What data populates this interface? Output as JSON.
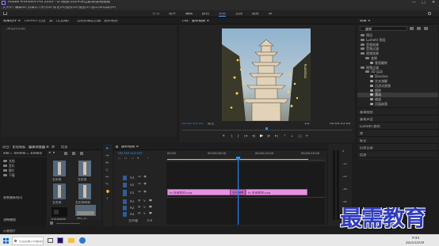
{
  "window": {
    "title": "Adobe Premiere Pro 2020 - D:\\视频\\1029\\导出影像\\影视模板",
    "controls": [
      "—",
      "□",
      "✕"
    ]
  },
  "menubar": [
    "文件(F)",
    "编辑(E)",
    "剪辑(C)",
    "序列(S)",
    "标记(M)",
    "图形(G)",
    "视图(V)",
    "窗口(W)",
    "帮助(H)"
  ],
  "workspaces": {
    "items": [
      "学习",
      "组件",
      "编辑",
      "颜色",
      "效果",
      "音频",
      "图形",
      "库"
    ],
    "active_index": 4
  },
  "source_panel": {
    "tabs": [
      "效果控件 ≡",
      "Lumetri 范围",
      "源：(无剪辑)",
      "音频剪辑混合器：旋转视频"
    ],
    "empty_text": "（未选择剪辑）"
  },
  "program_monitor": {
    "tab": "节目：旋转视频 ≡",
    "timecode_left": "00:00:03:00",
    "fit": "适合",
    "quality": "1/2",
    "timecode_right": "00:00:05:00",
    "watermark": "Kuaishou"
  },
  "effects_panel": {
    "title": "效果 ≡",
    "search_placeholder": "旋转",
    "tree": [
      {
        "label": "预设",
        "level": 0
      },
      {
        "label": "Lumetri 预设",
        "level": 0
      },
      {
        "label": "音频效果",
        "level": 0
      },
      {
        "label": "音频过渡",
        "level": 0
      },
      {
        "label": "视频效果",
        "level": 0
      },
      {
        "label": "变换",
        "level": 1
      },
      {
        "label": "垂直翻转",
        "level": 2
      },
      {
        "label": "视频过渡",
        "level": 0
      },
      {
        "label": "3D 运动",
        "level": 1
      },
      {
        "label": "Dissolve",
        "level": 2
      },
      {
        "label": "交叉溶解",
        "level": 2
      },
      {
        "label": "沉浸式视频",
        "level": 2
      },
      {
        "label": "擦除",
        "level": 2
      },
      {
        "label": "滑动",
        "level": 2
      },
      {
        "label": "缩放",
        "level": 2
      },
      {
        "label": "页面剥落",
        "level": 2
      }
    ],
    "selected_index": 13
  },
  "right_collapsed": [
    "基本图形",
    "基本声音",
    "Lumetri 颜色",
    "库",
    "标记",
    "历史记录",
    "信息"
  ],
  "project_panel": {
    "tabs": [
      "项目：影视模板",
      "媒体浏览器 ≡",
      "库",
      "信息"
    ],
    "path": "电脑 > 我的电脑 > 本地磁盘",
    "folders": [
      "文档",
      "音乐",
      "图片",
      "下载",
      "桌面",
      "视频"
    ],
    "labels": [
      "",
      "",
      "",
      "参数最新电讯",
      "",
      "",
      "流畅播放",
      "",
      "示意图片"
    ],
    "bottom_label": "影视素材",
    "items": [
      {
        "name": "五花帧"
      },
      {
        "name": "五花帧"
      },
      {
        "name": "五花帧"
      },
      {
        "name": "五花帧帧帧"
      },
      {
        "name": "五花帧帧帧"
      },
      {
        "name": "IMG_0..."
      }
    ]
  },
  "timeline": {
    "tab": "旋转视频 ≡",
    "timecode": "00:00:03:00",
    "ruler": [
      "00:00",
      "00:00:05:00",
      "00:00:10:00",
      "00:00:15:00"
    ],
    "video_tracks": [
      "V3",
      "V2",
      "V1"
    ],
    "audio_tracks": [
      "A1",
      "A2",
      "A3"
    ],
    "master": "主声道",
    "master_value": "0.0",
    "clip_a": "fx 竖屏素材.png",
    "clip_b": "fx 竖屏素材.png",
    "transition": "交叉溶解",
    "meter": [
      "0",
      "-12",
      "-24",
      "-36",
      "-48",
      "dB"
    ]
  },
  "taskbar": {
    "search_placeholder": "在这里输入你要搜索的内容",
    "time": "9:44",
    "date": "2021/10/19"
  },
  "brand_watermark": "最需教育",
  "colors": {
    "accent": "#2d8ceb",
    "clip": "#e493e0",
    "playhead": "#2e8bee",
    "workarea": "#d6c542",
    "brand": "#2f3cc0"
  }
}
